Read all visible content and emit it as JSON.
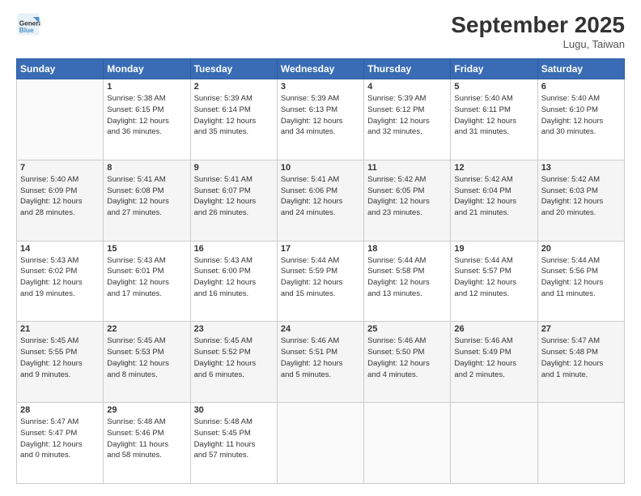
{
  "header": {
    "logo_line1": "General",
    "logo_line2": "Blue",
    "month": "September 2025",
    "location": "Lugu, Taiwan"
  },
  "weekdays": [
    "Sunday",
    "Monday",
    "Tuesday",
    "Wednesday",
    "Thursday",
    "Friday",
    "Saturday"
  ],
  "weeks": [
    [
      {
        "day": "",
        "info": ""
      },
      {
        "day": "1",
        "info": "Sunrise: 5:38 AM\nSunset: 6:15 PM\nDaylight: 12 hours\nand 36 minutes."
      },
      {
        "day": "2",
        "info": "Sunrise: 5:39 AM\nSunset: 6:14 PM\nDaylight: 12 hours\nand 35 minutes."
      },
      {
        "day": "3",
        "info": "Sunrise: 5:39 AM\nSunset: 6:13 PM\nDaylight: 12 hours\nand 34 minutes."
      },
      {
        "day": "4",
        "info": "Sunrise: 5:39 AM\nSunset: 6:12 PM\nDaylight: 12 hours\nand 32 minutes."
      },
      {
        "day": "5",
        "info": "Sunrise: 5:40 AM\nSunset: 6:11 PM\nDaylight: 12 hours\nand 31 minutes."
      },
      {
        "day": "6",
        "info": "Sunrise: 5:40 AM\nSunset: 6:10 PM\nDaylight: 12 hours\nand 30 minutes."
      }
    ],
    [
      {
        "day": "7",
        "info": "Sunrise: 5:40 AM\nSunset: 6:09 PM\nDaylight: 12 hours\nand 28 minutes."
      },
      {
        "day": "8",
        "info": "Sunrise: 5:41 AM\nSunset: 6:08 PM\nDaylight: 12 hours\nand 27 minutes."
      },
      {
        "day": "9",
        "info": "Sunrise: 5:41 AM\nSunset: 6:07 PM\nDaylight: 12 hours\nand 26 minutes."
      },
      {
        "day": "10",
        "info": "Sunrise: 5:41 AM\nSunset: 6:06 PM\nDaylight: 12 hours\nand 24 minutes."
      },
      {
        "day": "11",
        "info": "Sunrise: 5:42 AM\nSunset: 6:05 PM\nDaylight: 12 hours\nand 23 minutes."
      },
      {
        "day": "12",
        "info": "Sunrise: 5:42 AM\nSunset: 6:04 PM\nDaylight: 12 hours\nand 21 minutes."
      },
      {
        "day": "13",
        "info": "Sunrise: 5:42 AM\nSunset: 6:03 PM\nDaylight: 12 hours\nand 20 minutes."
      }
    ],
    [
      {
        "day": "14",
        "info": "Sunrise: 5:43 AM\nSunset: 6:02 PM\nDaylight: 12 hours\nand 19 minutes."
      },
      {
        "day": "15",
        "info": "Sunrise: 5:43 AM\nSunset: 6:01 PM\nDaylight: 12 hours\nand 17 minutes."
      },
      {
        "day": "16",
        "info": "Sunrise: 5:43 AM\nSunset: 6:00 PM\nDaylight: 12 hours\nand 16 minutes."
      },
      {
        "day": "17",
        "info": "Sunrise: 5:44 AM\nSunset: 5:59 PM\nDaylight: 12 hours\nand 15 minutes."
      },
      {
        "day": "18",
        "info": "Sunrise: 5:44 AM\nSunset: 5:58 PM\nDaylight: 12 hours\nand 13 minutes."
      },
      {
        "day": "19",
        "info": "Sunrise: 5:44 AM\nSunset: 5:57 PM\nDaylight: 12 hours\nand 12 minutes."
      },
      {
        "day": "20",
        "info": "Sunrise: 5:44 AM\nSunset: 5:56 PM\nDaylight: 12 hours\nand 11 minutes."
      }
    ],
    [
      {
        "day": "21",
        "info": "Sunrise: 5:45 AM\nSunset: 5:55 PM\nDaylight: 12 hours\nand 9 minutes."
      },
      {
        "day": "22",
        "info": "Sunrise: 5:45 AM\nSunset: 5:53 PM\nDaylight: 12 hours\nand 8 minutes."
      },
      {
        "day": "23",
        "info": "Sunrise: 5:45 AM\nSunset: 5:52 PM\nDaylight: 12 hours\nand 6 minutes."
      },
      {
        "day": "24",
        "info": "Sunrise: 5:46 AM\nSunset: 5:51 PM\nDaylight: 12 hours\nand 5 minutes."
      },
      {
        "day": "25",
        "info": "Sunrise: 5:46 AM\nSunset: 5:50 PM\nDaylight: 12 hours\nand 4 minutes."
      },
      {
        "day": "26",
        "info": "Sunrise: 5:46 AM\nSunset: 5:49 PM\nDaylight: 12 hours\nand 2 minutes."
      },
      {
        "day": "27",
        "info": "Sunrise: 5:47 AM\nSunset: 5:48 PM\nDaylight: 12 hours\nand 1 minute."
      }
    ],
    [
      {
        "day": "28",
        "info": "Sunrise: 5:47 AM\nSunset: 5:47 PM\nDaylight: 12 hours\nand 0 minutes."
      },
      {
        "day": "29",
        "info": "Sunrise: 5:48 AM\nSunset: 5:46 PM\nDaylight: 11 hours\nand 58 minutes."
      },
      {
        "day": "30",
        "info": "Sunrise: 5:48 AM\nSunset: 5:45 PM\nDaylight: 11 hours\nand 57 minutes."
      },
      {
        "day": "",
        "info": ""
      },
      {
        "day": "",
        "info": ""
      },
      {
        "day": "",
        "info": ""
      },
      {
        "day": "",
        "info": ""
      }
    ]
  ]
}
